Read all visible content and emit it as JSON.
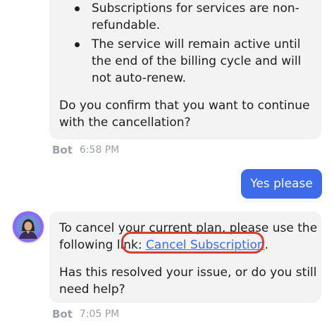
{
  "messages": [
    {
      "bullets": [
        "Subscriptions for services are non-refundable.",
        "The service will remain active until the end of the billing cycle and will not auto-renew."
      ],
      "question": "Do you confirm that you want to continue with the cancellation?",
      "sender": "Bot",
      "time": "6:58 PM"
    },
    {
      "user_text": "Yes please"
    },
    {
      "line_prefix": "To cancel your current plan, please use the following link: ",
      "link_label": "Cancel Subscription",
      "line_suffix": ".",
      "follow_up": "Has this resolved your issue, or do you still need help?",
      "sender": "Bot",
      "time": "7:05 PM"
    }
  ],
  "colors": {
    "user_bubble": "#3d6be9",
    "bot_bubble": "#f3f3f3",
    "link": "#3d6be9",
    "annotation_circle": "#d83e2c"
  },
  "icons": {
    "bot_avatar": "avatar-icon"
  }
}
